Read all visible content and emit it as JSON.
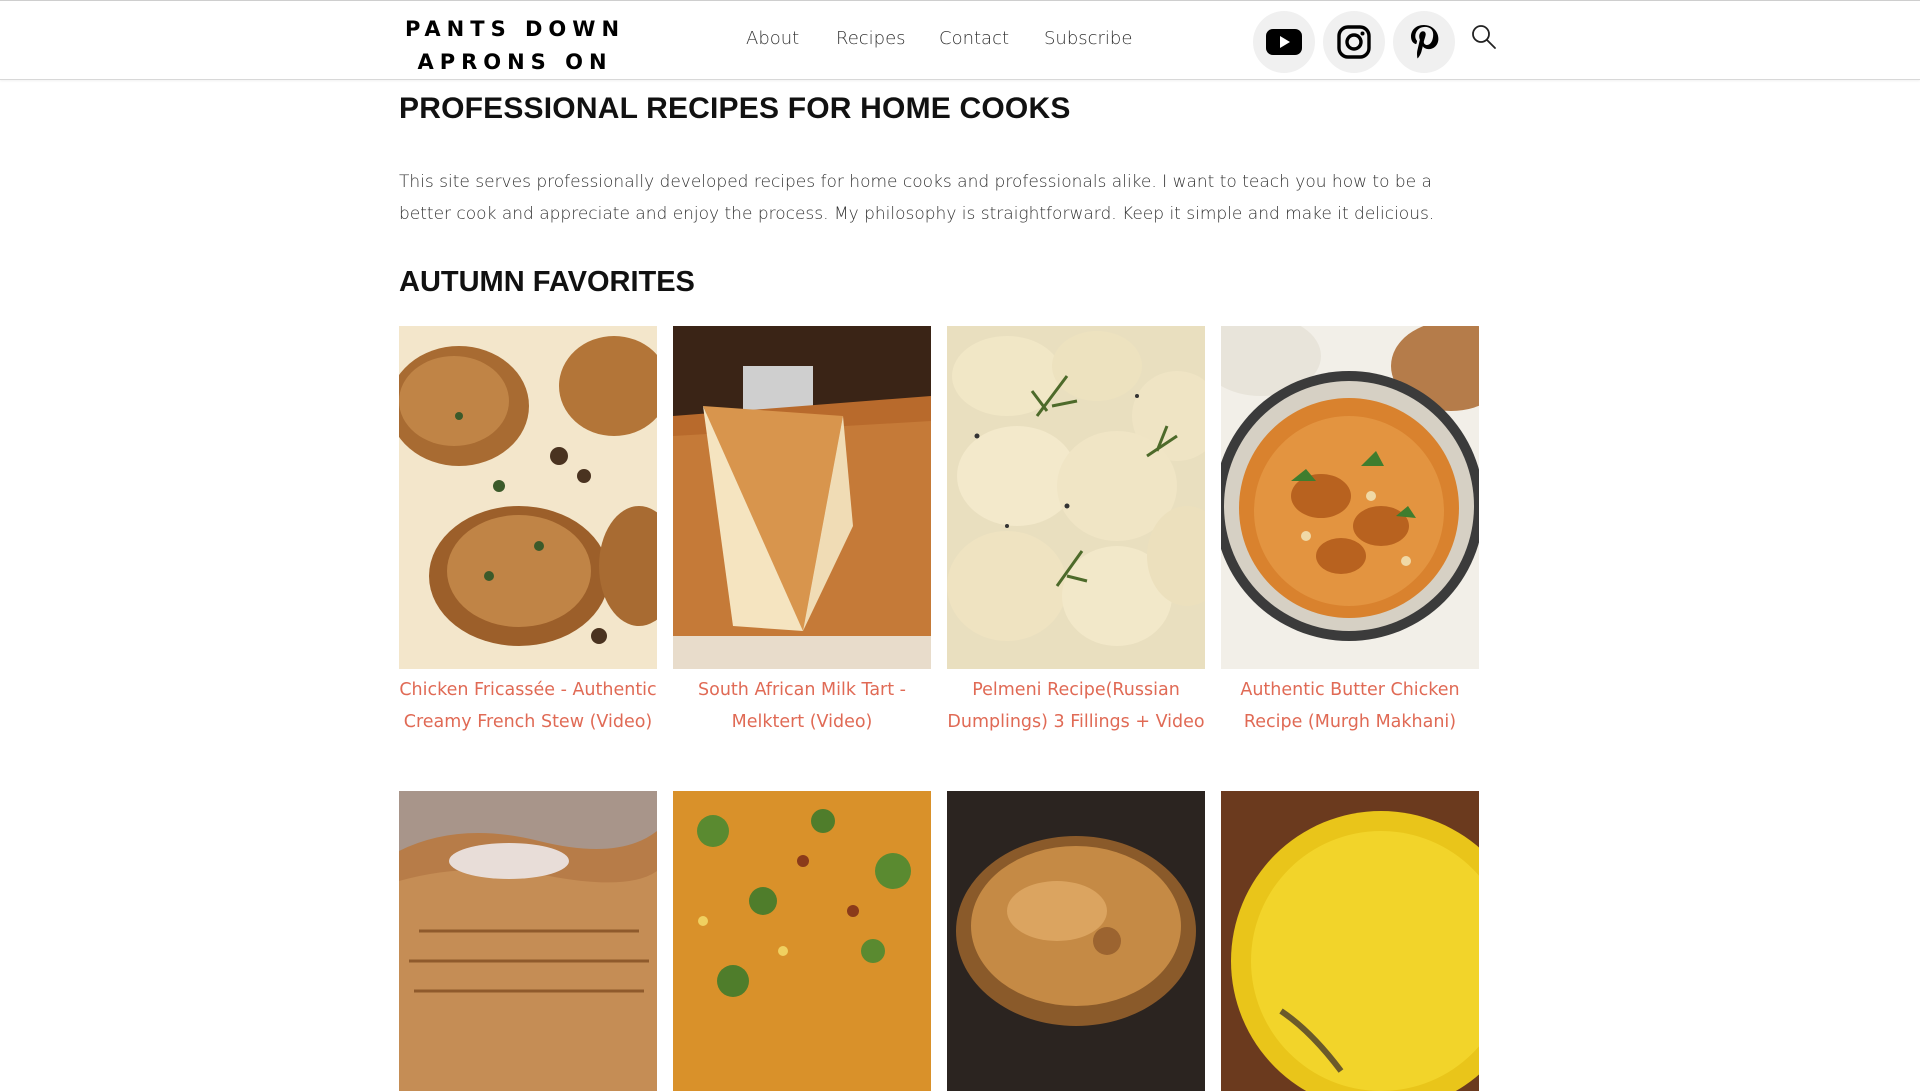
{
  "site": {
    "logo_line1": "PANTS DOWN",
    "logo_line2": "APRONS ON"
  },
  "nav": {
    "items": [
      {
        "label": "About"
      },
      {
        "label": "Recipes"
      },
      {
        "label": "Contact"
      },
      {
        "label": "Subscribe"
      }
    ]
  },
  "social": {
    "icons": [
      "youtube-icon",
      "instagram-icon",
      "pinterest-icon"
    ],
    "search_icon": "search-icon"
  },
  "main": {
    "heading": "PROFESSIONAL RECIPES FOR HOME COOKS",
    "intro": "This site serves professionally developed recipes for home cooks and professionals alike. I want to teach you how to be a better cook and appreciate and enjoy the process. My philosophy is straightforward. Keep it simple and make it delicious.",
    "section_title": "AUTUMN FAVORITES",
    "recipes": [
      {
        "title": "Chicken Fricassée - Authentic Creamy French Stew (Video)"
      },
      {
        "title": "South African Milk Tart - Melktert (Video)"
      },
      {
        "title": "Pelmeni Recipe(Russian Dumplings) 3 Fillings + Video"
      },
      {
        "title": "Authentic Butter Chicken Recipe (Murgh Makhani)"
      }
    ]
  },
  "colors": {
    "link": "#e06a55",
    "heading": "#111111",
    "text": "#333333"
  }
}
